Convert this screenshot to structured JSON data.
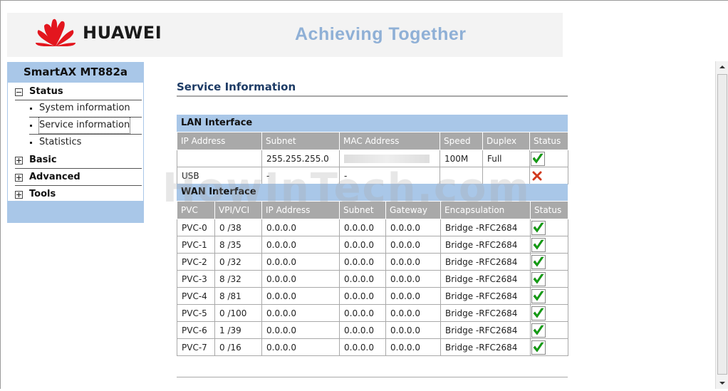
{
  "header": {
    "brand": "HUAWEI",
    "slogan": "Achieving Together",
    "logo_icon": "huawei-petal-logo-icon",
    "logo_color": "#e3161e"
  },
  "sidebar": {
    "title": "SmartAX MT882a",
    "items": [
      {
        "label": "Status",
        "expanded": true,
        "children": [
          {
            "label": "System information"
          },
          {
            "label": "Service information",
            "current": true
          },
          {
            "label": "Statistics"
          }
        ]
      },
      {
        "label": "Basic",
        "expanded": false
      },
      {
        "label": "Advanced",
        "expanded": false
      },
      {
        "label": "Tools",
        "expanded": false
      }
    ]
  },
  "main": {
    "title": "Service Information",
    "lan": {
      "heading": "LAN Interface",
      "columns": [
        "IP Address",
        "Subnet",
        "MAC Address",
        "Speed",
        "Duplex",
        "Status"
      ],
      "rows": [
        {
          "ip": "",
          "subnet": "255.255.255.0",
          "mac": "",
          "speed": "100M",
          "duplex": "Full",
          "status": "ok"
        },
        {
          "ip": "USB",
          "subnet": "-",
          "mac": "-",
          "speed": "",
          "duplex": "",
          "status": "down"
        }
      ]
    },
    "wan": {
      "heading": "WAN Interface",
      "columns": [
        "PVC",
        "VPI/VCI",
        "IP Address",
        "Subnet",
        "Gateway",
        "Encapsulation",
        "Status"
      ],
      "rows": [
        {
          "pvc": "PVC-0",
          "vpivci": "0 /38",
          "ip": "0.0.0.0",
          "subnet": "0.0.0.0",
          "gateway": "0.0.0.0",
          "encap": "Bridge -RFC2684",
          "status": "ok"
        },
        {
          "pvc": "PVC-1",
          "vpivci": "8 /35",
          "ip": "0.0.0.0",
          "subnet": "0.0.0.0",
          "gateway": "0.0.0.0",
          "encap": "Bridge -RFC2684",
          "status": "ok"
        },
        {
          "pvc": "PVC-2",
          "vpivci": "0 /32",
          "ip": "0.0.0.0",
          "subnet": "0.0.0.0",
          "gateway": "0.0.0.0",
          "encap": "Bridge -RFC2684",
          "status": "ok"
        },
        {
          "pvc": "PVC-3",
          "vpivci": "8 /32",
          "ip": "0.0.0.0",
          "subnet": "0.0.0.0",
          "gateway": "0.0.0.0",
          "encap": "Bridge -RFC2684",
          "status": "ok"
        },
        {
          "pvc": "PVC-4",
          "vpivci": "8 /81",
          "ip": "0.0.0.0",
          "subnet": "0.0.0.0",
          "gateway": "0.0.0.0",
          "encap": "Bridge -RFC2684",
          "status": "ok"
        },
        {
          "pvc": "PVC-5",
          "vpivci": "0 /100",
          "ip": "0.0.0.0",
          "subnet": "0.0.0.0",
          "gateway": "0.0.0.0",
          "encap": "Bridge -RFC2684",
          "status": "ok"
        },
        {
          "pvc": "PVC-6",
          "vpivci": "1 /39",
          "ip": "0.0.0.0",
          "subnet": "0.0.0.0",
          "gateway": "0.0.0.0",
          "encap": "Bridge -RFC2684",
          "status": "ok"
        },
        {
          "pvc": "PVC-7",
          "vpivci": "0 /16",
          "ip": "0.0.0.0",
          "subnet": "0.0.0.0",
          "gateway": "0.0.0.0",
          "encap": "Bridge -RFC2684",
          "status": "ok"
        }
      ]
    }
  },
  "watermark": "HowInTech.com",
  "colors": {
    "accent_band": "#a9c7e8",
    "header_cell": "#a9a9a9",
    "title_text": "#1e3c66",
    "ok_check": "#13a313",
    "down_x": "#d23a1e"
  }
}
